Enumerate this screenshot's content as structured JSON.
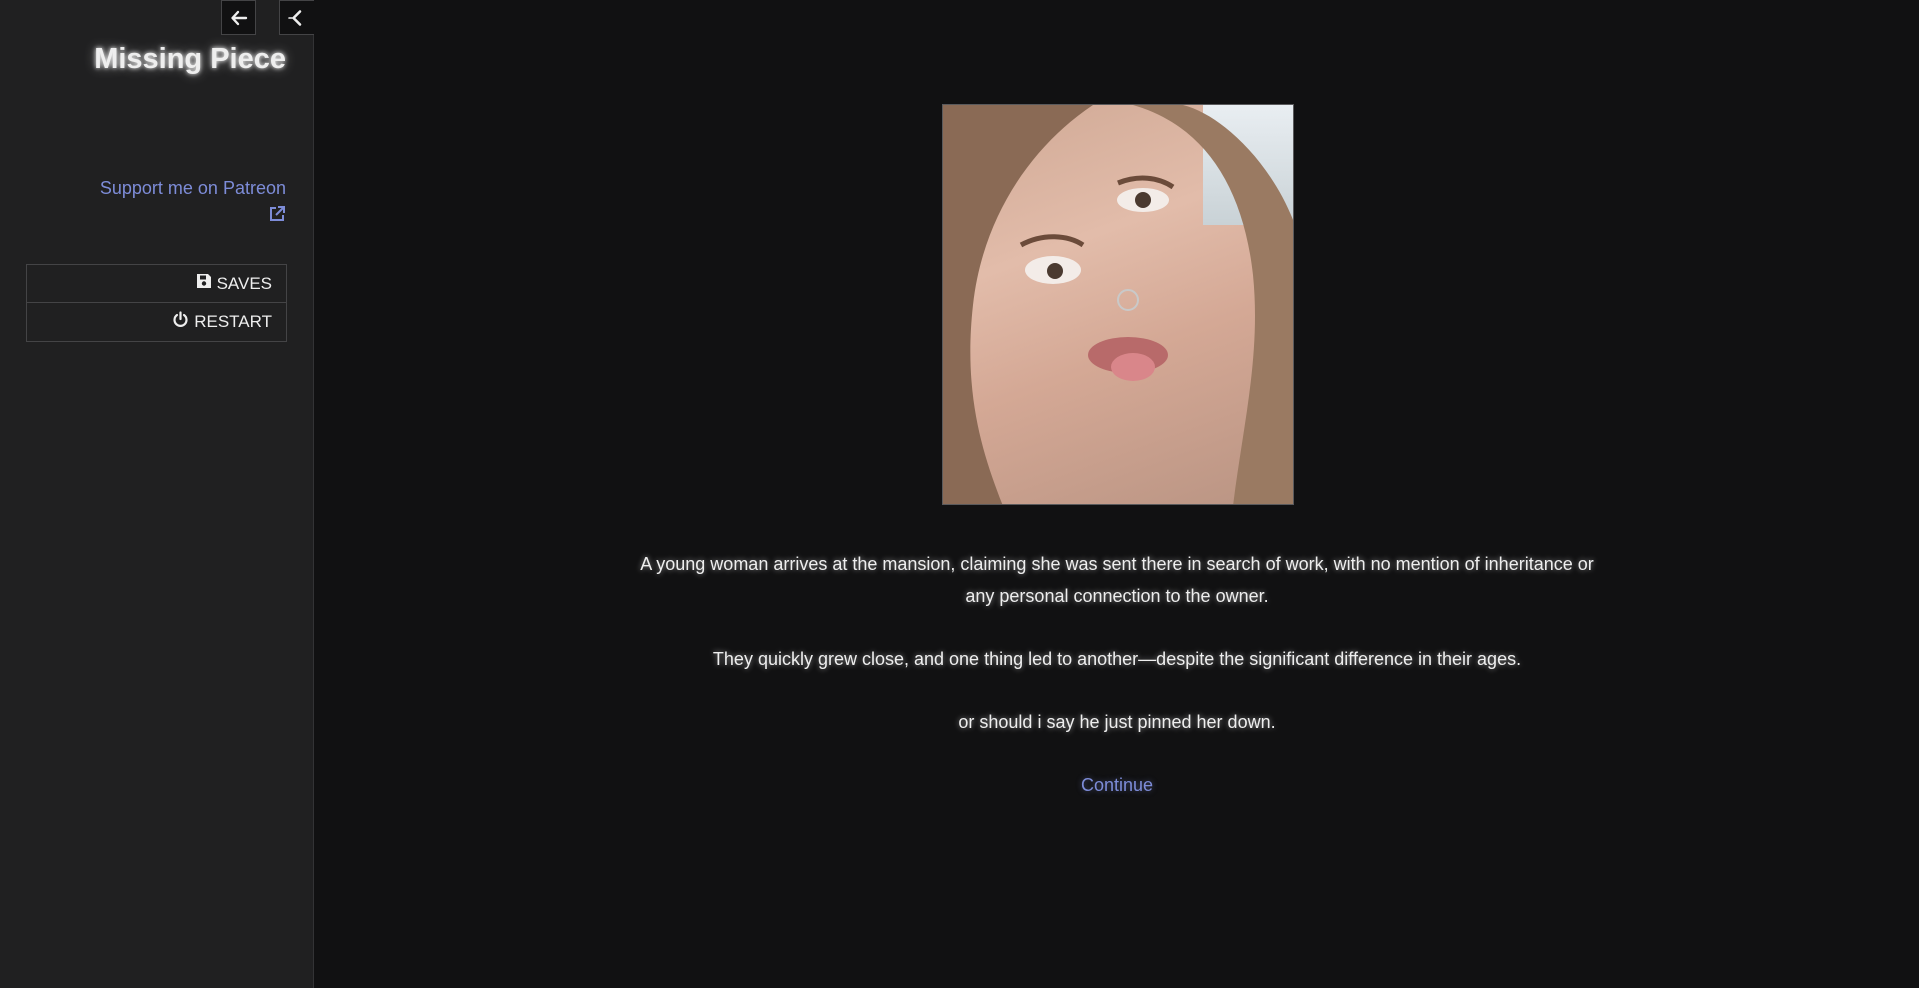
{
  "sidebar": {
    "title": "Missing Piece",
    "patreon_label": "Support me on Patreon",
    "menu": {
      "saves_label": "SAVES",
      "restart_label": "RESTART"
    }
  },
  "passage": {
    "paragraphs": [
      "A young woman arrives at the mansion, claiming she was sent there in search of work, with no mention of inheritance or any personal connection to the owner.",
      "They quickly grew close, and one thing led to another—despite the significant difference in their ages.",
      "or should i say he just pinned her down."
    ],
    "continue_label": "Continue"
  },
  "icons": {
    "history_back": "arrow-left-icon",
    "sidebar_toggle": "chevron-left-icon",
    "external_link": "external-link-icon",
    "saves": "floppy-disk-icon",
    "restart": "power-icon"
  },
  "colors": {
    "background": "#111112",
    "sidebar": "#202021",
    "link": "#7d8cd8",
    "text": "#eeeeee"
  }
}
